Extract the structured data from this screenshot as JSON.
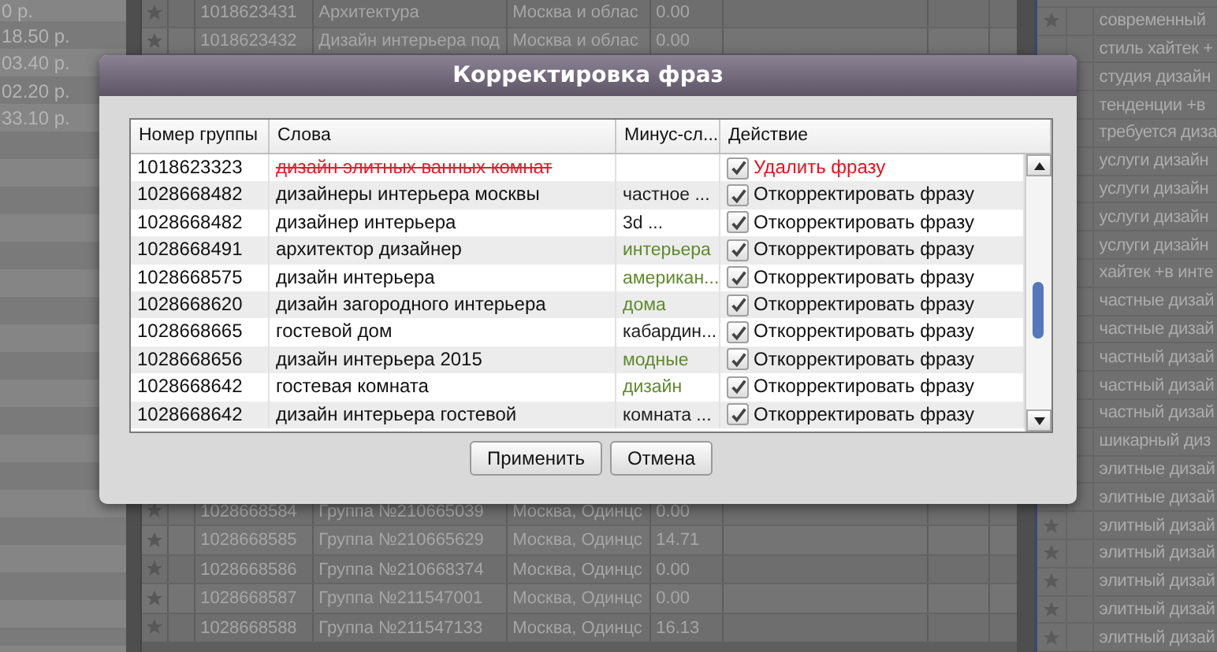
{
  "background": {
    "left_panel": {
      "rows": [
        "0 р.",
        "18.50 р.",
        "03.40 р.",
        "02.20 р.",
        "33.10 р."
      ]
    },
    "groups_table": {
      "top_rows": [
        {
          "id": "1018623431",
          "name": "Архитектура",
          "region": "Москва и облас",
          "value": "0.00"
        },
        {
          "id": "1018623432",
          "name": "Дизайн интерьера под",
          "region": "Москва и облас",
          "value": "0.00"
        }
      ],
      "bottom_rows": [
        {
          "id": "1028668584",
          "name": "Группа №210665039",
          "region": "Москва, Одинцс",
          "value": "0.00"
        },
        {
          "id": "1028668585",
          "name": "Группа №210665629",
          "region": "Москва, Одинцс",
          "value": "14.71"
        },
        {
          "id": "1028668586",
          "name": "Группа №210668374",
          "region": "Москва, Одинцс",
          "value": "0.00"
        },
        {
          "id": "1028668587",
          "name": "Группа №211547001",
          "region": "Москва, Одинцс",
          "value": "0.00"
        },
        {
          "id": "1028668588",
          "name": "Группа №211547133",
          "region": "Москва, Одинцс",
          "value": "16.13"
        }
      ]
    },
    "phrases_panel": {
      "rows": [
        "современный",
        "стиль хайтек +",
        "студия дизайн",
        "тенденции +в",
        "требуется диза",
        "услуги дизайн",
        "услуги дизайн",
        "услуги дизайн",
        "услуги дизайн",
        "хайтек +в инте",
        "частные дизай",
        "частные дизай",
        "частный дизай",
        "частный дизай",
        "частный дизай",
        "шикарный диз",
        "элитные дизай",
        "элитные дизай",
        "элитный дизай",
        "элитный дизай",
        "элитный дизай",
        "элитный дизай",
        "элитный дизай"
      ]
    }
  },
  "dialog": {
    "title": "Корректировка фраз",
    "columns": [
      "Номер группы",
      "Слова",
      "Минус-сл...",
      "Действие"
    ],
    "rows": [
      {
        "group": "1018623323",
        "words": "дизайн элитных ванных комнат",
        "kind": "delete",
        "checked": true,
        "action": "Удалить фразу"
      },
      {
        "group": "1028668482",
        "words": "дизайнеры интерьера москвы",
        "minus": {
          "text": "частное ...",
          "color": "#1e1e1e"
        },
        "kind": "correct",
        "checked": true,
        "action": "Откорректировать фразу"
      },
      {
        "group": "1028668482",
        "words": "дизайнер интерьера",
        "minus": {
          "text": "3d ...",
          "color": "#1e1e1e"
        },
        "kind": "correct",
        "checked": true,
        "action": "Откорректировать фразу"
      },
      {
        "group": "1028668491",
        "words": "архитектор дизайнер",
        "minus": {
          "text": "интерьера",
          "color": "#5f8a2c"
        },
        "kind": "correct",
        "checked": true,
        "action": "Откорректировать фразу"
      },
      {
        "group": "1028668575",
        "words": "дизайн интерьера",
        "minus": {
          "text": "американ...",
          "color": "#5f8a2c"
        },
        "kind": "correct",
        "checked": true,
        "action": "Откорректировать фразу"
      },
      {
        "group": "1028668620",
        "words": "дизайн загородного интерьера",
        "minus": {
          "text": "дома",
          "color": "#5f8a2c"
        },
        "kind": "correct",
        "checked": true,
        "action": "Откорректировать фразу"
      },
      {
        "group": "1028668665",
        "words": "гостевой дом",
        "minus": {
          "text": "кабардин...",
          "color": "#1e1e1e"
        },
        "kind": "correct",
        "checked": true,
        "action": "Откорректировать фразу"
      },
      {
        "group": "1028668656",
        "words": "дизайн интерьера 2015",
        "minus": {
          "text": "модные",
          "color": "#5f8a2c"
        },
        "kind": "correct",
        "checked": true,
        "action": "Откорректировать фразу"
      },
      {
        "group": "1028668642",
        "words": "гостевая комната",
        "minus": {
          "text": "дизайн",
          "color": "#5f8a2c"
        },
        "kind": "correct",
        "checked": true,
        "action": "Откорректировать фразу"
      },
      {
        "group": "1028668642",
        "words": "дизайн интерьера гостевой",
        "minus": {
          "text": "комната ...",
          "color": "#1e1e1e"
        },
        "kind": "correct",
        "checked": true,
        "action": "Откорректировать фразу"
      }
    ],
    "buttons": [
      "Применить",
      "Отмена"
    ]
  }
}
